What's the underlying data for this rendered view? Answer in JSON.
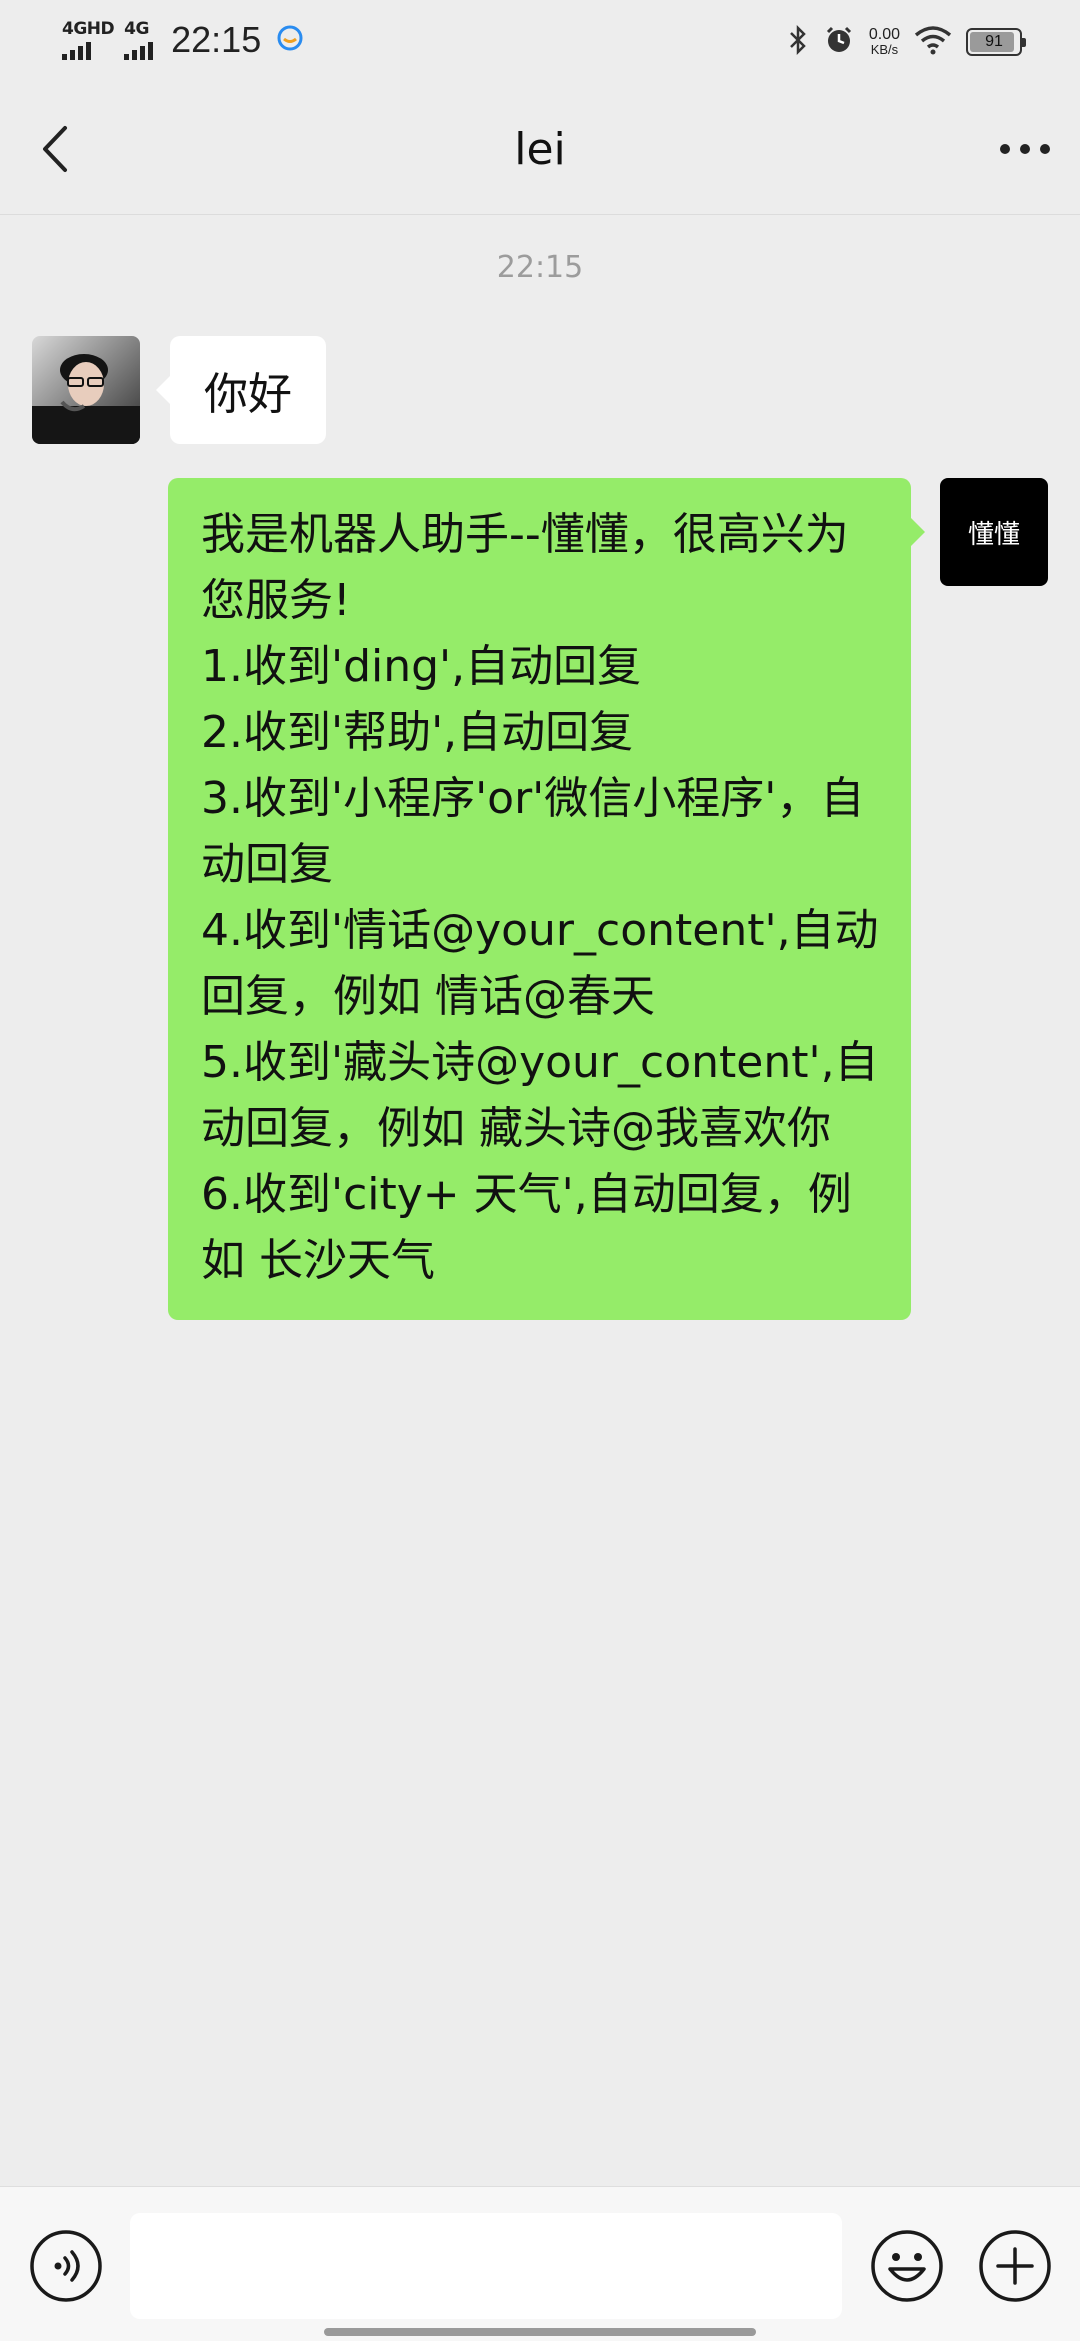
{
  "status_bar": {
    "network1": "4GHD",
    "network2": "4G",
    "time": "22:15",
    "speed_value": "0.00",
    "speed_unit": "KB/s",
    "battery_percent": "91",
    "battery_level": 0.91
  },
  "header": {
    "title": "lei"
  },
  "chat": {
    "timestamp": "22:15",
    "messages": [
      {
        "sender": "lei",
        "side": "left",
        "text": "你好"
      },
      {
        "sender": "懂懂",
        "side": "right",
        "avatar_text": "懂懂",
        "lines": [
          "我是机器人助手--懂懂，很高兴为",
          "您服务!",
          "1.收到'ding',自动回复",
          "2.收到'帮助',自动回复",
          "3.收到'小程序'or'微信小程序'，自",
          "动回复",
          "4.收到'情话@your_content',自动",
          "回复，例如 情话@春天",
          "5.收到'藏头诗@your_content',自",
          "动回复，例如 藏头诗@我喜欢你",
          "6.收到'city+ 天气',自动回复，例",
          "如 长沙天气"
        ]
      }
    ]
  },
  "input_bar": {
    "value": "",
    "icons": [
      "voice-icon",
      "emoji-icon",
      "plus-icon"
    ]
  },
  "colors": {
    "background": "#ededed",
    "outgoing_bubble": "#95ec69",
    "incoming_bubble": "#ffffff",
    "bot_avatar": "#000000"
  }
}
